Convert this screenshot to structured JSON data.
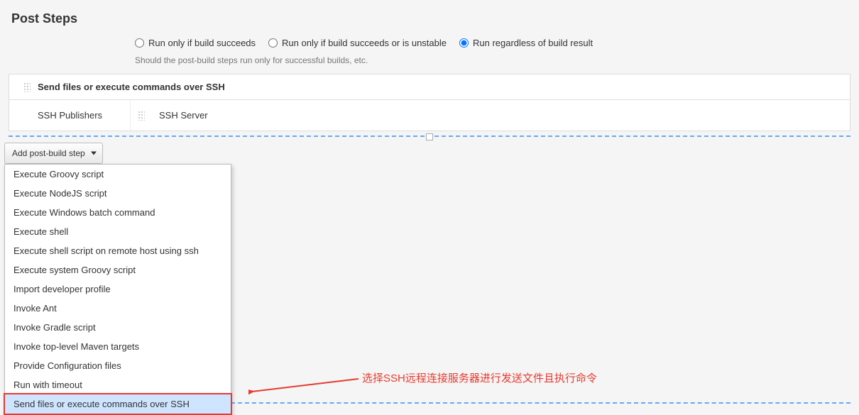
{
  "section_title": "Post Steps",
  "radios": {
    "opt1": "Run only if build succeeds",
    "opt2": "Run only if build succeeds or is unstable",
    "opt3": "Run regardless of build result"
  },
  "helper": "Should the post-build steps run only for successful builds, etc.",
  "ssh_panel": {
    "title": "Send files or execute commands over SSH",
    "publishers_label": "SSH Publishers",
    "server_label": "SSH Server"
  },
  "add_button": "Add post-build step",
  "dropdown_items": [
    "Execute Groovy script",
    "Execute NodeJS script",
    "Execute Windows batch command",
    "Execute shell",
    "Execute shell script on remote host using ssh",
    "Execute system Groovy script",
    "Import developer profile",
    "Invoke Ant",
    "Invoke Gradle script",
    "Invoke top-level Maven targets",
    "Provide Configuration files",
    "Run with timeout",
    "Send files or execute commands over SSH"
  ],
  "selected_index": 12,
  "annotation": "选择SSH远程连接服务器进行发送文件且执行命令"
}
